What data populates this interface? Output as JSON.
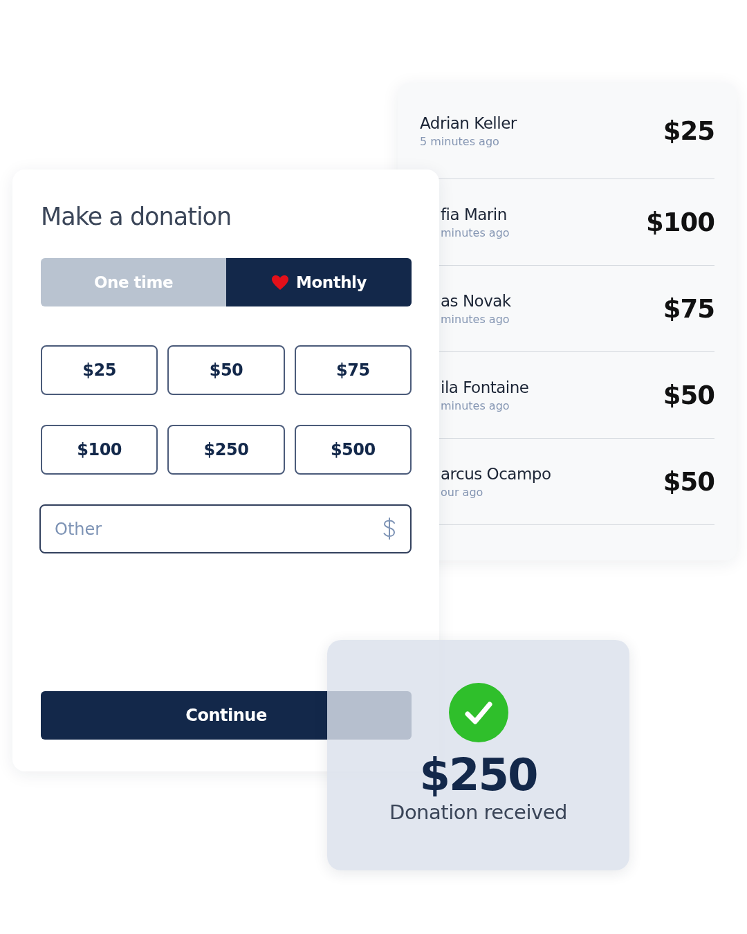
{
  "donors": [
    {
      "name": "Adrian Keller",
      "time": "5 minutes ago",
      "amount": "$25"
    },
    {
      "name": "fia Marin",
      "time": "minutes ago",
      "amount": "$100"
    },
    {
      "name": "as Novak",
      "time": "minutes ago",
      "amount": "$75"
    },
    {
      "name": "ila Fontaine",
      "time": "minutes ago",
      "amount": "$50"
    },
    {
      "name": "arcus Ocampo",
      "time": "our ago",
      "amount": "$50"
    }
  ],
  "form": {
    "title": "Make a donation",
    "frequency": [
      {
        "label": "One time",
        "selected": false
      },
      {
        "label": "Monthly",
        "selected": true
      }
    ],
    "amounts": [
      {
        "label": "$25",
        "selected": false
      },
      {
        "label": "$50",
        "selected": false
      },
      {
        "label": "$75",
        "selected": false
      },
      {
        "label": "$100",
        "selected": false
      },
      {
        "label": "$250",
        "selected": false
      },
      {
        "label": "$500",
        "selected": false
      }
    ],
    "other": {
      "placeholder": "Other"
    },
    "continue": "Continue"
  },
  "confirmation": {
    "amount": "$250",
    "message": "Donation received"
  }
}
